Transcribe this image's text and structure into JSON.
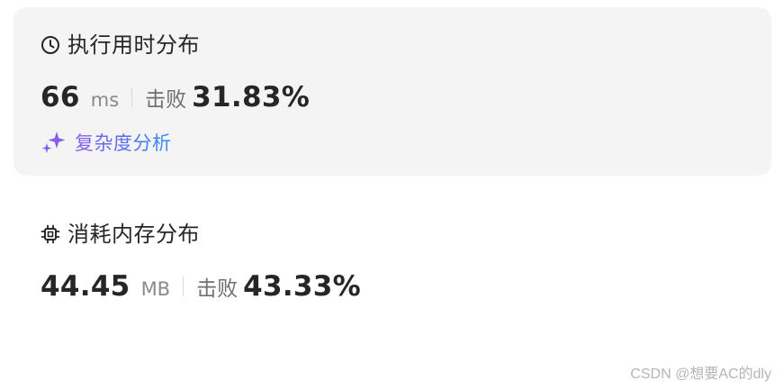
{
  "runtime": {
    "title": "执行用时分布",
    "value": "66",
    "unit": "ms",
    "beat_label": "击败",
    "beat_pct": "31.83%",
    "complexity_link": "复杂度分析"
  },
  "memory": {
    "title": "消耗内存分布",
    "value": "44.45",
    "unit": "MB",
    "beat_label": "击败",
    "beat_pct": "43.33%"
  },
  "watermark": "CSDN @想要AC的dly",
  "icons": {
    "runtime": "clock-icon",
    "memory": "chip-icon",
    "complexity": "sparkle-icon"
  },
  "colors": {
    "card_bg": "#f4f4f5",
    "text_primary": "#262626",
    "text_secondary": "#8a8a8e",
    "link_gradient_start": "#8c5cf0",
    "link_gradient_end": "#2f8ef0"
  }
}
